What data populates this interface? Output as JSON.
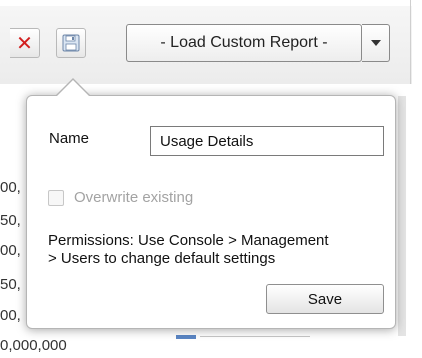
{
  "toolbar": {
    "delete_icon": "close-icon",
    "save_icon": "floppy-disk-icon",
    "report_select": {
      "selected": "- Load Custom Report -"
    }
  },
  "background": {
    "values": [
      "00,",
      "50,",
      "00,",
      "50,",
      "00,",
      "0,000,000"
    ]
  },
  "save_popup": {
    "name_label": "Name",
    "name_value": "Usage Details",
    "overwrite_label": "Overwrite existing",
    "permissions_line1": "Permissions: Use Console > Management",
    "permissions_line2": "> Users to change default settings",
    "save_label": "Save"
  },
  "colors": {
    "delete_red": "#d21f1f",
    "accent_blue": "#5b86c5"
  }
}
